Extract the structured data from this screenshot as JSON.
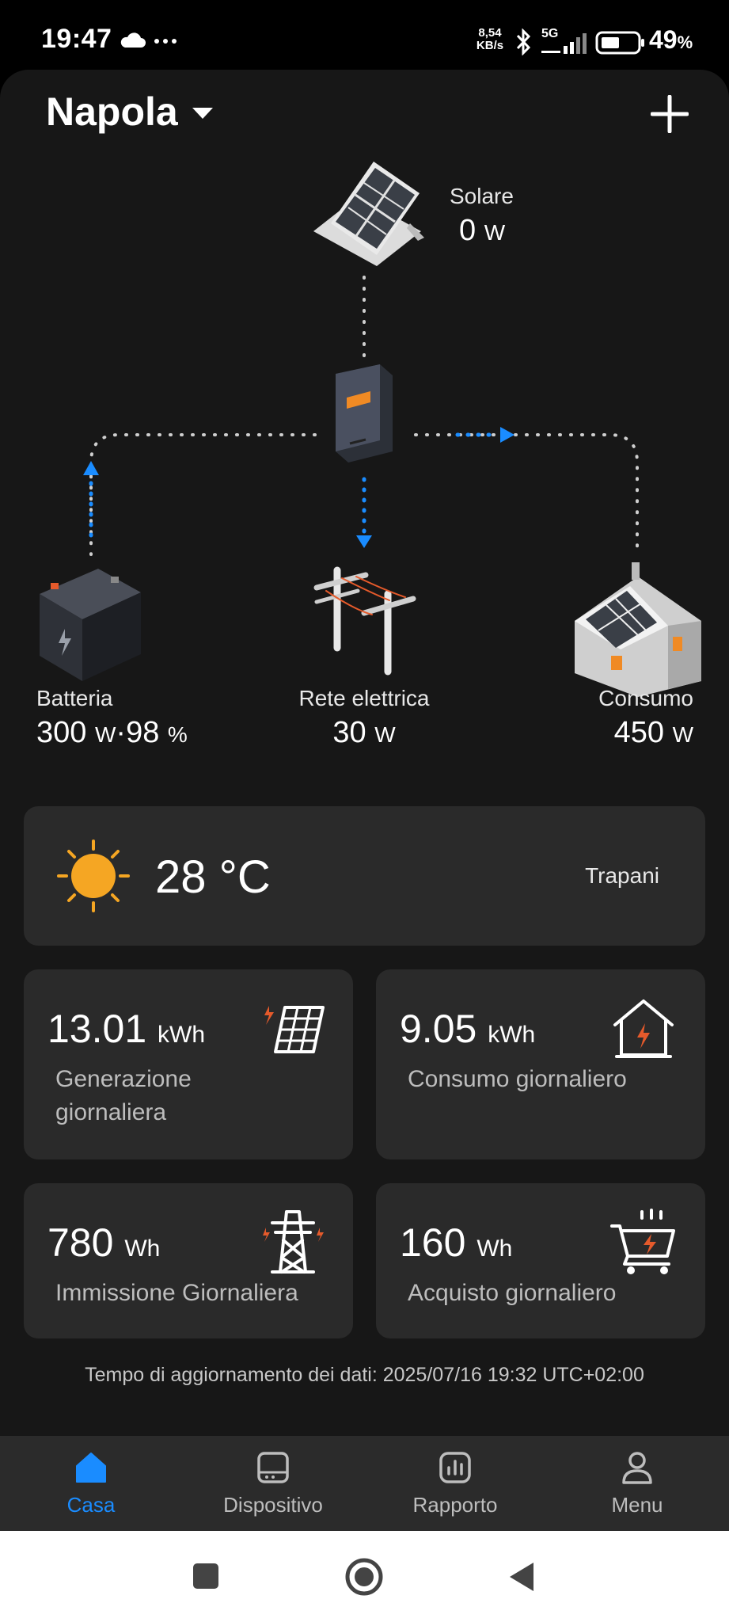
{
  "status_bar": {
    "time": "19:47",
    "net_speed_value": "8,54",
    "net_speed_unit": "KB/s",
    "network": "5G",
    "battery_value": "49",
    "battery_unit": "%"
  },
  "header": {
    "location": "Napola"
  },
  "energy_flow": {
    "solar": {
      "label": "Solare",
      "value": "0",
      "unit": "W"
    },
    "battery": {
      "label": "Batteria",
      "value": "300",
      "unit": "W",
      "separator": "·",
      "percent": "98",
      "percent_unit": "%"
    },
    "grid": {
      "label": "Rete elettrica",
      "value": "30",
      "unit": "W"
    },
    "consumption": {
      "label": "Consumo",
      "value": "450",
      "unit": "W"
    }
  },
  "weather": {
    "temperature": "28 °C",
    "city": "Trapani",
    "icon": "sun-icon"
  },
  "stats": [
    {
      "value": "13.01",
      "unit": "kWh",
      "label_line1": "Generazione",
      "label_line2": "giornaliera",
      "icon": "solar-panel-icon"
    },
    {
      "value": "9.05",
      "unit": "kWh",
      "label_line1": "Consumo giornaliero",
      "icon": "home-energy-icon"
    },
    {
      "value": "780",
      "unit": "Wh",
      "label_line1": "Immissione Giornaliera",
      "icon": "power-tower-icon"
    },
    {
      "value": "160",
      "unit": "Wh",
      "label_line1": "Acquisto giornaliero",
      "icon": "cart-icon"
    }
  ],
  "updated": "Tempo di aggiornamento dei dati: 2025/07/16 19:32 UTC+02:00",
  "nav": [
    {
      "label": "Casa",
      "active": true
    },
    {
      "label": "Dispositivo",
      "active": false
    },
    {
      "label": "Rapporto",
      "active": false
    },
    {
      "label": "Menu",
      "active": false
    }
  ],
  "colors": {
    "accent": "#1a8cff",
    "background": "#171717",
    "card": "#2a2a2a",
    "sun": "#f5a623"
  }
}
